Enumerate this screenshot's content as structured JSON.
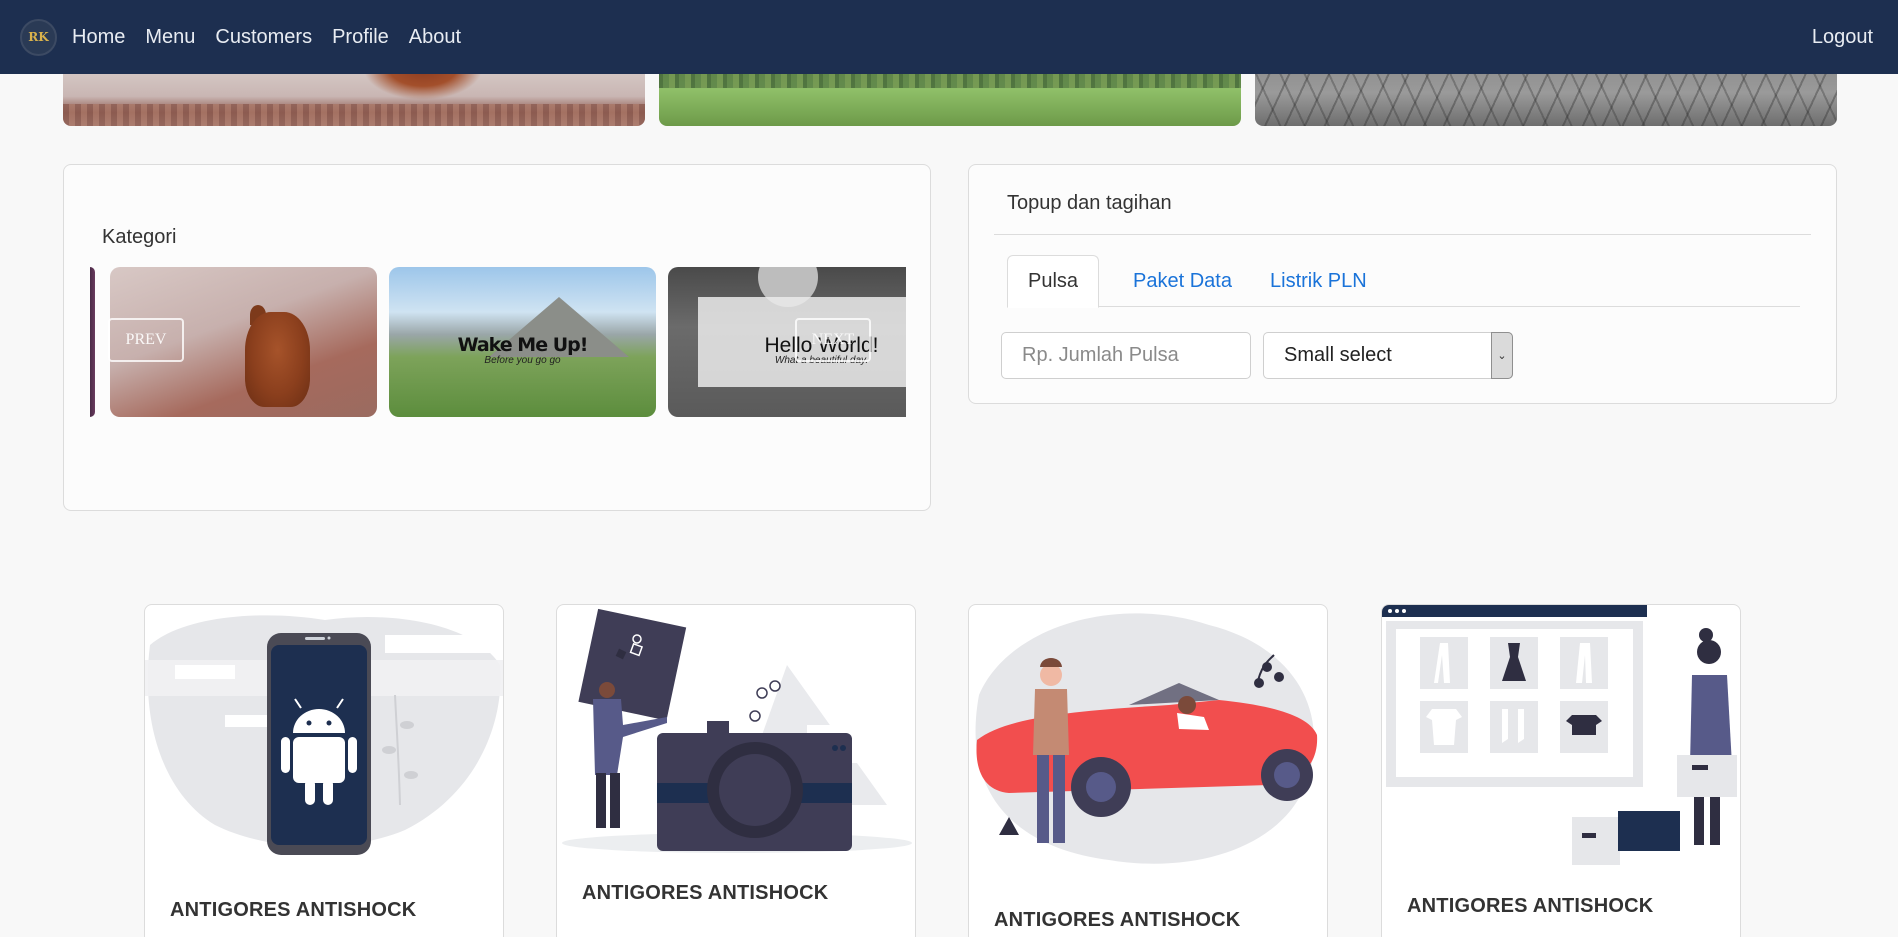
{
  "navbar": {
    "logo_text": "RK",
    "links": [
      "Home",
      "Menu",
      "Customers",
      "Profile",
      "About"
    ],
    "logout": "Logout"
  },
  "kategori": {
    "title": "Kategori",
    "slides": [
      {
        "heading": "Wake Me Up!",
        "subheading": "Before you go go"
      },
      {
        "heading": "Hello World!",
        "subheading": "What a beautiful day."
      }
    ],
    "prev_label": "PREV",
    "next_label": "NEXT"
  },
  "topup": {
    "title": "Topup dan tagihan",
    "tabs": [
      "Pulsa",
      "Paket Data",
      "Listrik PLN"
    ],
    "active_tab": "Pulsa",
    "amount_placeholder": "Rp. Jumlah Pulsa",
    "select_value": "Small select"
  },
  "products": [
    {
      "title": "ANTIGORES ANTISHOCK",
      "illustration": "android-phone"
    },
    {
      "title": "ANTIGORES ANTISHOCK",
      "illustration": "camera"
    },
    {
      "title": "ANTIGORES ANTISHOCK",
      "illustration": "car"
    },
    {
      "title": "ANTIGORES ANTISHOCK",
      "illustration": "online-shop"
    }
  ],
  "colors": {
    "navbar": "#1d2f50",
    "link": "#1a73d9",
    "illustration_dark": "#2f2e41",
    "illustration_accent": "#f24e4e"
  }
}
